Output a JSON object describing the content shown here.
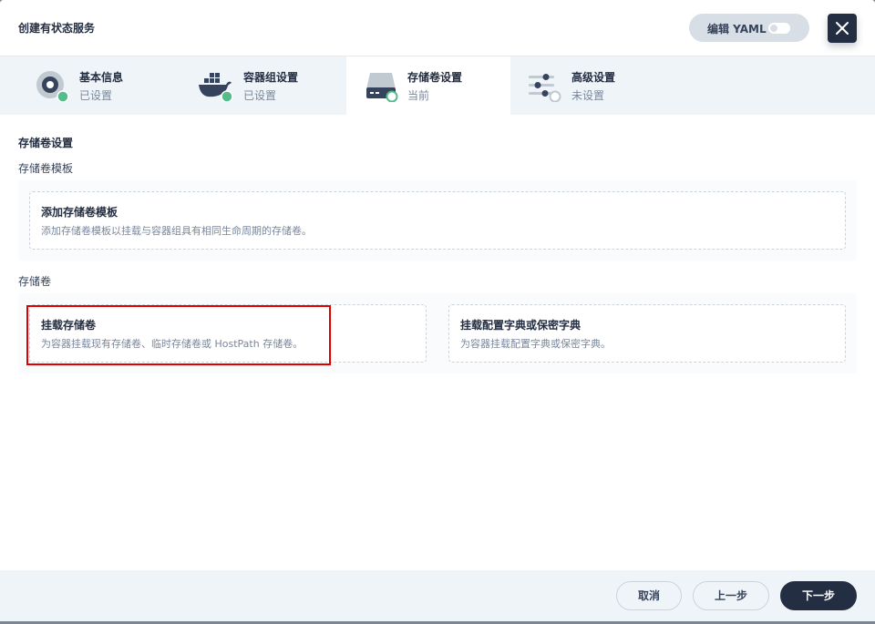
{
  "header": {
    "title": "创建有状态服务",
    "yaml_label": "编辑 YAML"
  },
  "steps": [
    {
      "name": "基本信息",
      "status": "已设置",
      "icon": "basic-info-icon"
    },
    {
      "name": "容器组设置",
      "status": "已设置",
      "icon": "docker-icon"
    },
    {
      "name": "存储卷设置",
      "status": "当前",
      "icon": "storage-icon"
    },
    {
      "name": "高级设置",
      "status": "未设置",
      "icon": "sliders-icon"
    }
  ],
  "content": {
    "section_title": "存储卷设置",
    "template_label": "存储卷模板",
    "template_card": {
      "title": "添加存储卷模板",
      "desc": "添加存储卷模板以挂载与容器组具有相同生命周期的存储卷。"
    },
    "volume_label": "存储卷",
    "mount_card": {
      "title": "挂载存储卷",
      "desc": "为容器挂载现有存储卷、临时存储卷或 HostPath 存储卷。"
    },
    "config_card": {
      "title": "挂载配置字典或保密字典",
      "desc": "为容器挂载配置字典或保密字典。"
    }
  },
  "footer": {
    "cancel": "取消",
    "prev": "上一步",
    "next": "下一步"
  },
  "colors": {
    "primary_dark": "#242e42",
    "success_green": "#55bc8a",
    "highlight_red": "#e00000"
  }
}
